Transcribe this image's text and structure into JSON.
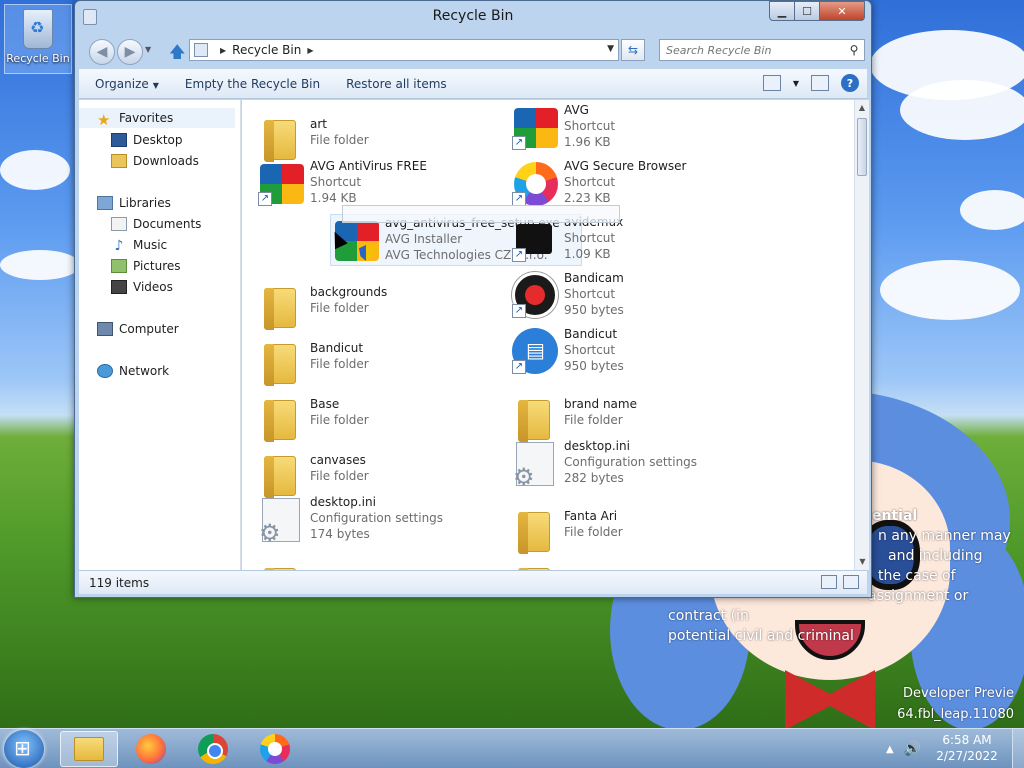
{
  "desktop": {
    "recycle_bin_label": "Recycle Bin",
    "watermark": {
      "title": "ential",
      "lines": [
        "n any manner may",
        "and including",
        "the case of",
        "assignment or",
        "contract (in",
        "potential civil and criminal"
      ],
      "footer_1": "Developer Previe",
      "footer_2": "64.fbl_leap.11080"
    }
  },
  "window": {
    "title": "Recycle Bin",
    "address": {
      "location": "Recycle Bin"
    },
    "search": {
      "placeholder": "Search Recycle Bin"
    },
    "toolbar": {
      "organize": "Organize",
      "empty": "Empty the Recycle Bin",
      "restore": "Restore all items"
    },
    "nav": {
      "favorites": "Favorites",
      "desktop": "Desktop",
      "downloads": "Downloads",
      "libraries": "Libraries",
      "documents": "Documents",
      "music": "Music",
      "pictures": "Pictures",
      "videos": "Videos",
      "computer": "Computer",
      "network": "Network"
    },
    "files": [
      {
        "name": "art",
        "line2": "File folder",
        "line3": "",
        "icon": "folder-icon"
      },
      {
        "name": "AVG",
        "line2": "Shortcut",
        "line3": "1.96 KB",
        "icon": "avg-icon"
      },
      {
        "name": "AVG AntiVirus FREE",
        "line2": "Shortcut",
        "line3": "1.94 KB",
        "icon": "avg-icon"
      },
      {
        "name": "AVG Secure Browser",
        "line2": "Shortcut",
        "line3": "2.23 KB",
        "icon": "avg-secure-browser-icon"
      },
      {
        "name": "avg_antivirus_free_setup.exe",
        "line2": "AVG Installer",
        "line3": "AVG Technologies CZ, s.r.o.",
        "icon": "avg-installer-icon"
      },
      {
        "name": "avidemux",
        "line2": "Shortcut",
        "line3": "1.09 KB",
        "icon": "avidemux-icon"
      },
      {
        "name": "backgrounds",
        "line2": "File folder",
        "line3": "",
        "icon": "folder-icon"
      },
      {
        "name": "Bandicam",
        "line2": "Shortcut",
        "line3": "950 bytes",
        "icon": "bandicam-icon"
      },
      {
        "name": "Bandicut",
        "line2": "File folder",
        "line3": "",
        "icon": "folder-icon"
      },
      {
        "name": "Bandicut",
        "line2": "Shortcut",
        "line3": "950 bytes",
        "icon": "bandicut-icon"
      },
      {
        "name": "Base",
        "line2": "File folder",
        "line3": "",
        "icon": "folder-icon"
      },
      {
        "name": "brand name",
        "line2": "File folder",
        "line3": "",
        "icon": "folder-icon"
      },
      {
        "name": "canvases",
        "line2": "File folder",
        "line3": "",
        "icon": "folder-icon"
      },
      {
        "name": "desktop.ini",
        "line2": "Configuration settings",
        "line3": "282 bytes",
        "icon": "config-file-icon"
      },
      {
        "name": "desktop.ini",
        "line2": "Configuration settings",
        "line3": "174 bytes",
        "icon": "config-file-icon"
      },
      {
        "name": "Fanta Ari",
        "line2": "File folder",
        "line3": "",
        "icon": "folder-icon"
      }
    ],
    "status": {
      "item_count": "119 items"
    }
  },
  "taskbar": {
    "clock_time": "6:58 AM",
    "clock_date": "2/27/2022"
  }
}
